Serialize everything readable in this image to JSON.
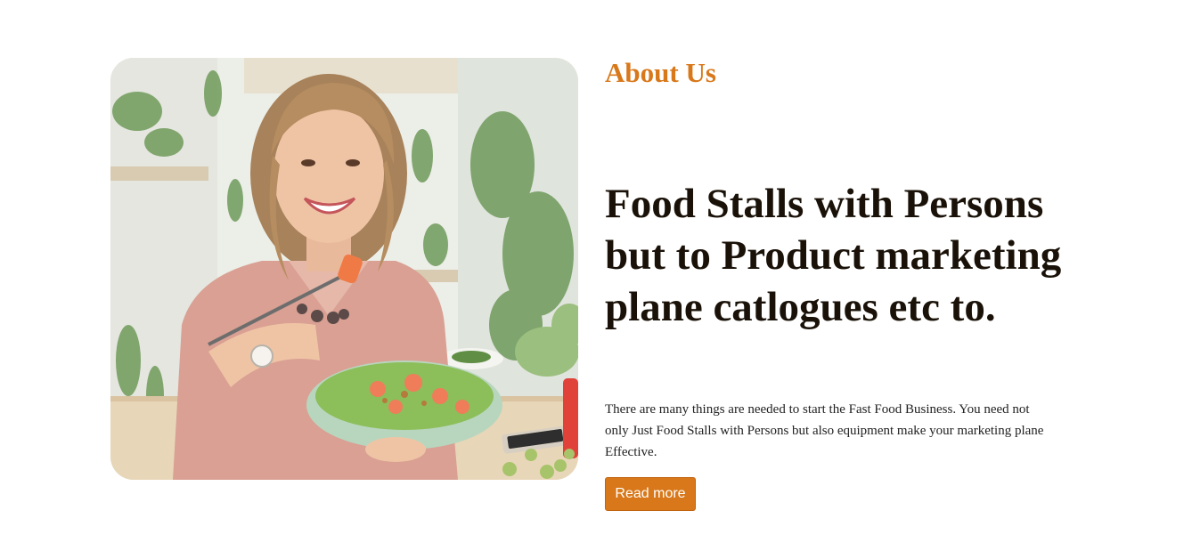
{
  "about": {
    "eyebrow": "About Us",
    "headline": "Food Stalls with Persons but to Product marketing plane catlogues etc to.",
    "description": "There are many things are needed to start the Fast Food Business. You need not only Just Food Stalls with Persons but also equipment make your marketing plane Effective.",
    "button_label": "Read more"
  },
  "colors": {
    "accent": "#d8781a",
    "heading": "#1a1208",
    "body": "#222222",
    "background": "#ffffff"
  },
  "image": {
    "subject": "smiling woman eating salad"
  }
}
